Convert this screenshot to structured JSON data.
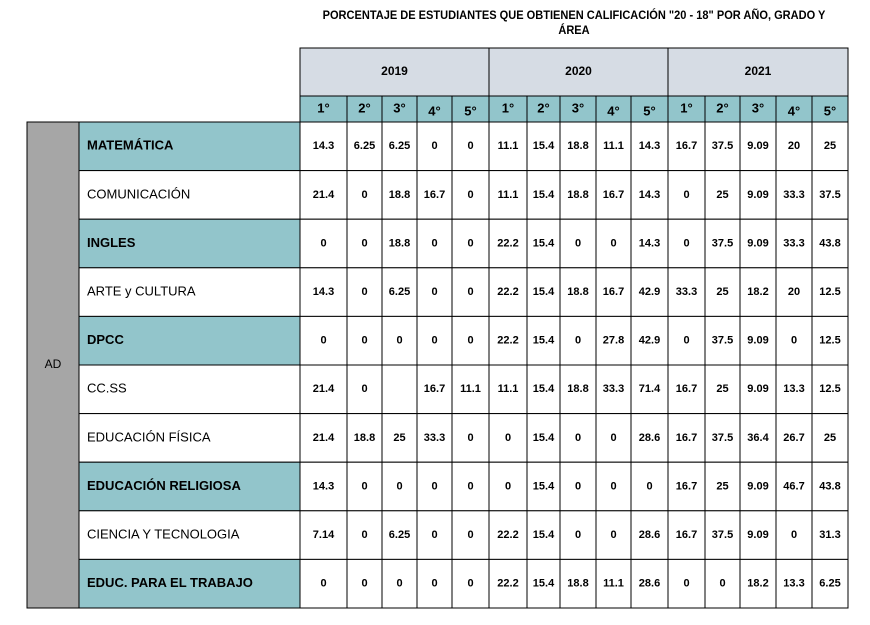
{
  "chart_data": {
    "type": "table",
    "title": "PORCENTAJE DE ESTUDIANTES QUE OBTIENEN CALIFICACIÓN \"20 - 18\" POR AÑO, GRADO Y ÁREA",
    "level": "AD",
    "years": [
      "2019",
      "2020",
      "2021"
    ],
    "grades": [
      "1°",
      "2°",
      "3°",
      "4°",
      "5°"
    ],
    "rows": [
      {
        "area": "MATEMÁTICA",
        "highlight": true,
        "values": [
          "14.3",
          "6.25",
          "6.25",
          "0",
          "0",
          "11.1",
          "15.4",
          "18.8",
          "11.1",
          "14.3",
          "16.7",
          "37.5",
          "9.09",
          "20",
          "25"
        ]
      },
      {
        "area": "COMUNICACIÓN",
        "highlight": false,
        "values": [
          "21.4",
          "0",
          "18.8",
          "16.7",
          "0",
          "11.1",
          "15.4",
          "18.8",
          "16.7",
          "14.3",
          "0",
          "25",
          "9.09",
          "33.3",
          "37.5"
        ]
      },
      {
        "area": "INGLES",
        "highlight": true,
        "values": [
          "0",
          "0",
          "18.8",
          "0",
          "0",
          "22.2",
          "15.4",
          "0",
          "0",
          "14.3",
          "0",
          "37.5",
          "9.09",
          "33.3",
          "43.8"
        ]
      },
      {
        "area": "ARTE y CULTURA",
        "highlight": false,
        "values": [
          "14.3",
          "0",
          "6.25",
          "0",
          "0",
          "22.2",
          "15.4",
          "18.8",
          "16.7",
          "42.9",
          "33.3",
          "25",
          "18.2",
          "20",
          "12.5"
        ]
      },
      {
        "area": "DPCC",
        "highlight": true,
        "values": [
          "0",
          "0",
          "0",
          "0",
          "0",
          "22.2",
          "15.4",
          "0",
          "27.8",
          "42.9",
          "0",
          "37.5",
          "9.09",
          "0",
          "12.5"
        ]
      },
      {
        "area": "CC.SS",
        "highlight": false,
        "values": [
          "21.4",
          "0",
          "",
          "16.7",
          "11.1",
          "11.1",
          "15.4",
          "18.8",
          "33.3",
          "71.4",
          "16.7",
          "25",
          "9.09",
          "13.3",
          "12.5"
        ]
      },
      {
        "area": "EDUCACIÓN FÍSICA",
        "highlight": false,
        "values": [
          "21.4",
          "18.8",
          "25",
          "33.3",
          "0",
          "0",
          "15.4",
          "0",
          "0",
          "28.6",
          "16.7",
          "37.5",
          "36.4",
          "26.7",
          "25"
        ]
      },
      {
        "area": "EDUCACIÓN RELIGIOSA",
        "highlight": true,
        "values": [
          "14.3",
          "0",
          "0",
          "0",
          "0",
          "0",
          "15.4",
          "0",
          "0",
          "0",
          "16.7",
          "25",
          "9.09",
          "46.7",
          "43.8"
        ]
      },
      {
        "area": "CIENCIA Y TECNOLOGIA",
        "highlight": false,
        "values": [
          "7.14",
          "0",
          "6.25",
          "0",
          "0",
          "22.2",
          "15.4",
          "0",
          "0",
          "28.6",
          "16.7",
          "37.5",
          "9.09",
          "0",
          "31.3"
        ]
      },
      {
        "area": "EDUC. PARA EL TRABAJO",
        "highlight": true,
        "values": [
          "0",
          "0",
          "0",
          "0",
          "0",
          "22.2",
          "15.4",
          "18.8",
          "11.1",
          "28.6",
          "0",
          "0",
          "18.2",
          "13.3",
          "6.25"
        ]
      }
    ]
  },
  "colors": {
    "year_header_bg": "#d6dce4",
    "grade_header_bg": "#92c5cb",
    "highlight_bg": "#92c5cb",
    "level_bg": "#a6a6a6",
    "border": "#000000"
  }
}
